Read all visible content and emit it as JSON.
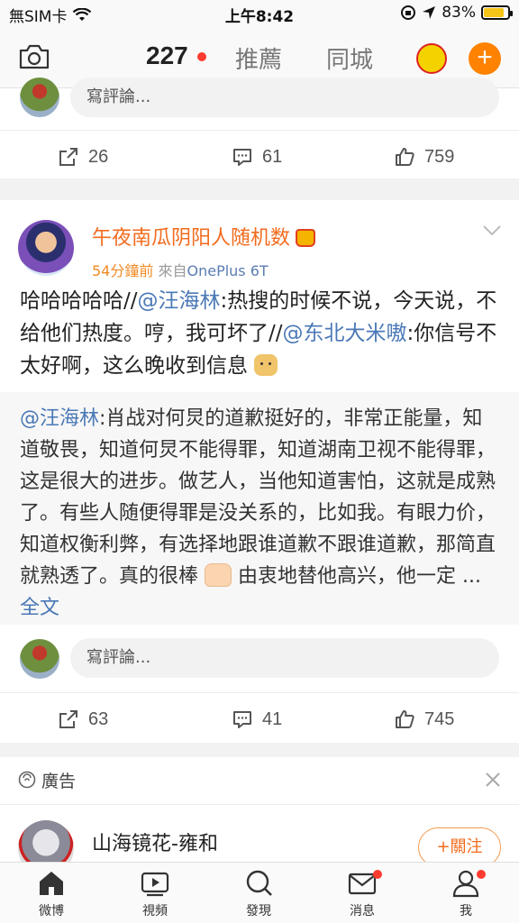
{
  "status_bar": {
    "carrier": "無SIM卡",
    "time": "上午8:42",
    "battery": "83%",
    "battery_level": 0.83
  },
  "nav": {
    "tabs": [
      {
        "label": "227",
        "active": true
      },
      {
        "label": "推薦",
        "active": false
      },
      {
        "label": "同城",
        "active": false
      }
    ],
    "add_label": "+"
  },
  "top_card": {
    "comment_placeholder": "寫評論...",
    "actions": {
      "repost": "26",
      "comment": "61",
      "like": "759"
    }
  },
  "post": {
    "author": "午夜南瓜阴阳人随机数",
    "time": "54分鐘前",
    "source_prefix": "來自",
    "device": "OnePlus 6T",
    "text_parts": {
      "p1": "哈哈哈哈哈//",
      "m1": "@汪海林",
      "p2": ":热搜的时候不说，今天说，不给他们热度。哼，我可坏了//",
      "m2": "@东北大米嗷",
      "p3": ":你信号不太好啊，这么晚收到信息"
    },
    "repost": {
      "mention": "@汪海林",
      "text": ":肖战对何炅的道歉挺好的，非常正能量，知道敬畏，知道何炅不能得罪，知道湖南卫视不能得罪，这是很大的进步。做艺人，当他知道害怕，这就是成熟了。有些人随便得罪是没关系的，比如我。有眼力价，知道权衡利弊，有选择地跟谁道歉不跟谁道歉，那简直就熟透了。真的很棒",
      "tail": " 由衷地替他高兴，他一定 ...",
      "full_link": "全文"
    },
    "comment_placeholder": "寫評論...",
    "actions": {
      "repost": "63",
      "comment": "41",
      "like": "745"
    }
  },
  "ad": {
    "label": "廣告",
    "name": "山海镜花-雍和",
    "follow": "+關注"
  },
  "tabbar": {
    "items": [
      {
        "label": "微博",
        "icon": "home-icon"
      },
      {
        "label": "視頻",
        "icon": "video-icon"
      },
      {
        "label": "發現",
        "icon": "search-icon"
      },
      {
        "label": "消息",
        "icon": "mail-icon"
      },
      {
        "label": "我",
        "icon": "profile-icon"
      }
    ]
  },
  "colors": {
    "accent": "#ff8200",
    "username": "#f26b1d",
    "link": "#4a78b6",
    "badge": "#ff3b30"
  }
}
